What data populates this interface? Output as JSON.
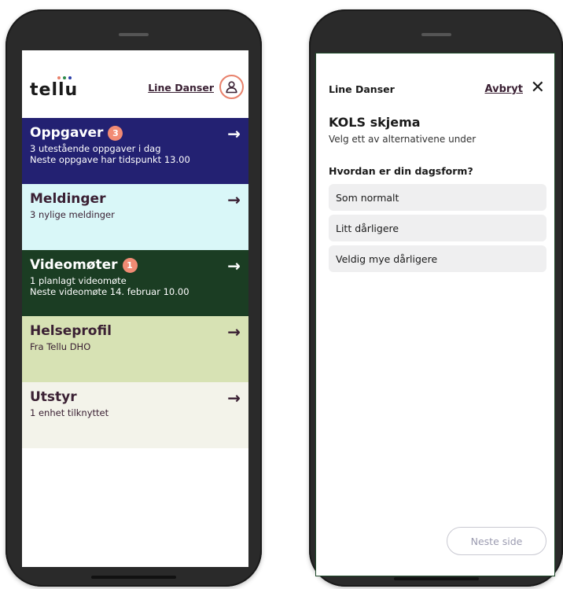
{
  "left_app": {
    "logo_text": "tellu",
    "logo_dot_colors": [
      "#e8816b",
      "#2a8a4a",
      "#2a3fa8"
    ],
    "user_name": "Line Danser",
    "cards": [
      {
        "key": "oppgaver",
        "title": "Oppgaver",
        "badge": "3",
        "lines": [
          "3 utestående oppgaver i dag",
          "Neste oppgave har tidspunkt 13.00"
        ],
        "bg": "#232172"
      },
      {
        "key": "meldinger",
        "title": "Meldinger",
        "badge": "",
        "lines": [
          "3 nylige meldinger",
          ""
        ],
        "bg": "#d9f7f8"
      },
      {
        "key": "videomoter",
        "title": "Videomøter",
        "badge": "1",
        "lines": [
          "1 planlagt videomøte",
          "Neste videomøte 14. februar 10.00"
        ],
        "bg": "#1b3d23"
      },
      {
        "key": "helseprofil",
        "title": "Helseprofil",
        "badge": "",
        "lines": [
          "Fra Tellu DHO",
          ""
        ],
        "bg": "#d7e2b4"
      },
      {
        "key": "utstyr",
        "title": "Utstyr",
        "badge": "",
        "lines": [
          "1 enhet tilknyttet",
          ""
        ],
        "bg": "#f3f3ea"
      }
    ],
    "arrow": "→"
  },
  "right_app": {
    "user_name": "Line Danser",
    "cancel_label": "Avbryt",
    "close_glyph": "✕",
    "form_title": "KOLS skjema",
    "form_subtitle": "Velg ett av alternativene under",
    "question": "Hvordan er din dagsform?",
    "options": [
      "Som normalt",
      "Litt dårligere",
      "Veldig mye dårligere"
    ],
    "next_label": "Neste side"
  }
}
